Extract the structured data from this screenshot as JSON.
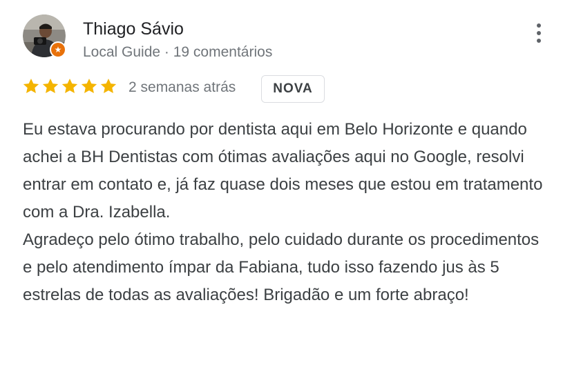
{
  "reviewer": {
    "name": "Thiago Sávio",
    "meta": "Local Guide · 19 comentários",
    "avatar_icon": "person-photo-icon",
    "badge_icon": "local-guide-star-icon"
  },
  "rating": {
    "stars": 5,
    "max": 5,
    "star_color": "#f4b400",
    "date": "2 semanas atrás",
    "badge": "NOVA"
  },
  "review": {
    "paragraph_1": "Eu estava procurando por dentista aqui em Belo Horizonte e quando achei a BH Dentistas com ótimas avaliações aqui no Google, resolvi entrar em contato e, já faz quase dois meses que estou em tratamento com a Dra. Izabella.",
    "paragraph_2": "Agradeço pelo ótimo trabalho, pelo cuidado durante os procedimentos e pelo atendimento ímpar da Fabiana, tudo isso fazendo jus às 5 estrelas de todas as avaliações! Brigadão e um forte abraço!"
  },
  "menu": {
    "icon": "more-vert-icon"
  }
}
